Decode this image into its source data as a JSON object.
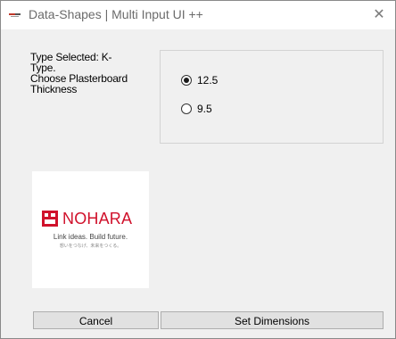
{
  "window": {
    "title": "Data-Shapes | Multi Input UI ++",
    "close_glyph": "✕",
    "icon": "app-logo-icon"
  },
  "form": {
    "type_label": "Type Selected: K-Type.",
    "choose_label": "Choose Plasterboard Thickness"
  },
  "thickness": {
    "selected": "12.5",
    "options": [
      "12.5",
      "9.5"
    ]
  },
  "logo": {
    "name": "NOHARA",
    "tagline": "Link ideas. Build future.",
    "tagline_jp": "想いをつなげ、未来をつくる。",
    "accent_color": "#d0112b"
  },
  "buttons": {
    "cancel_label": "Cancel",
    "set_label": "Set Dimensions"
  }
}
